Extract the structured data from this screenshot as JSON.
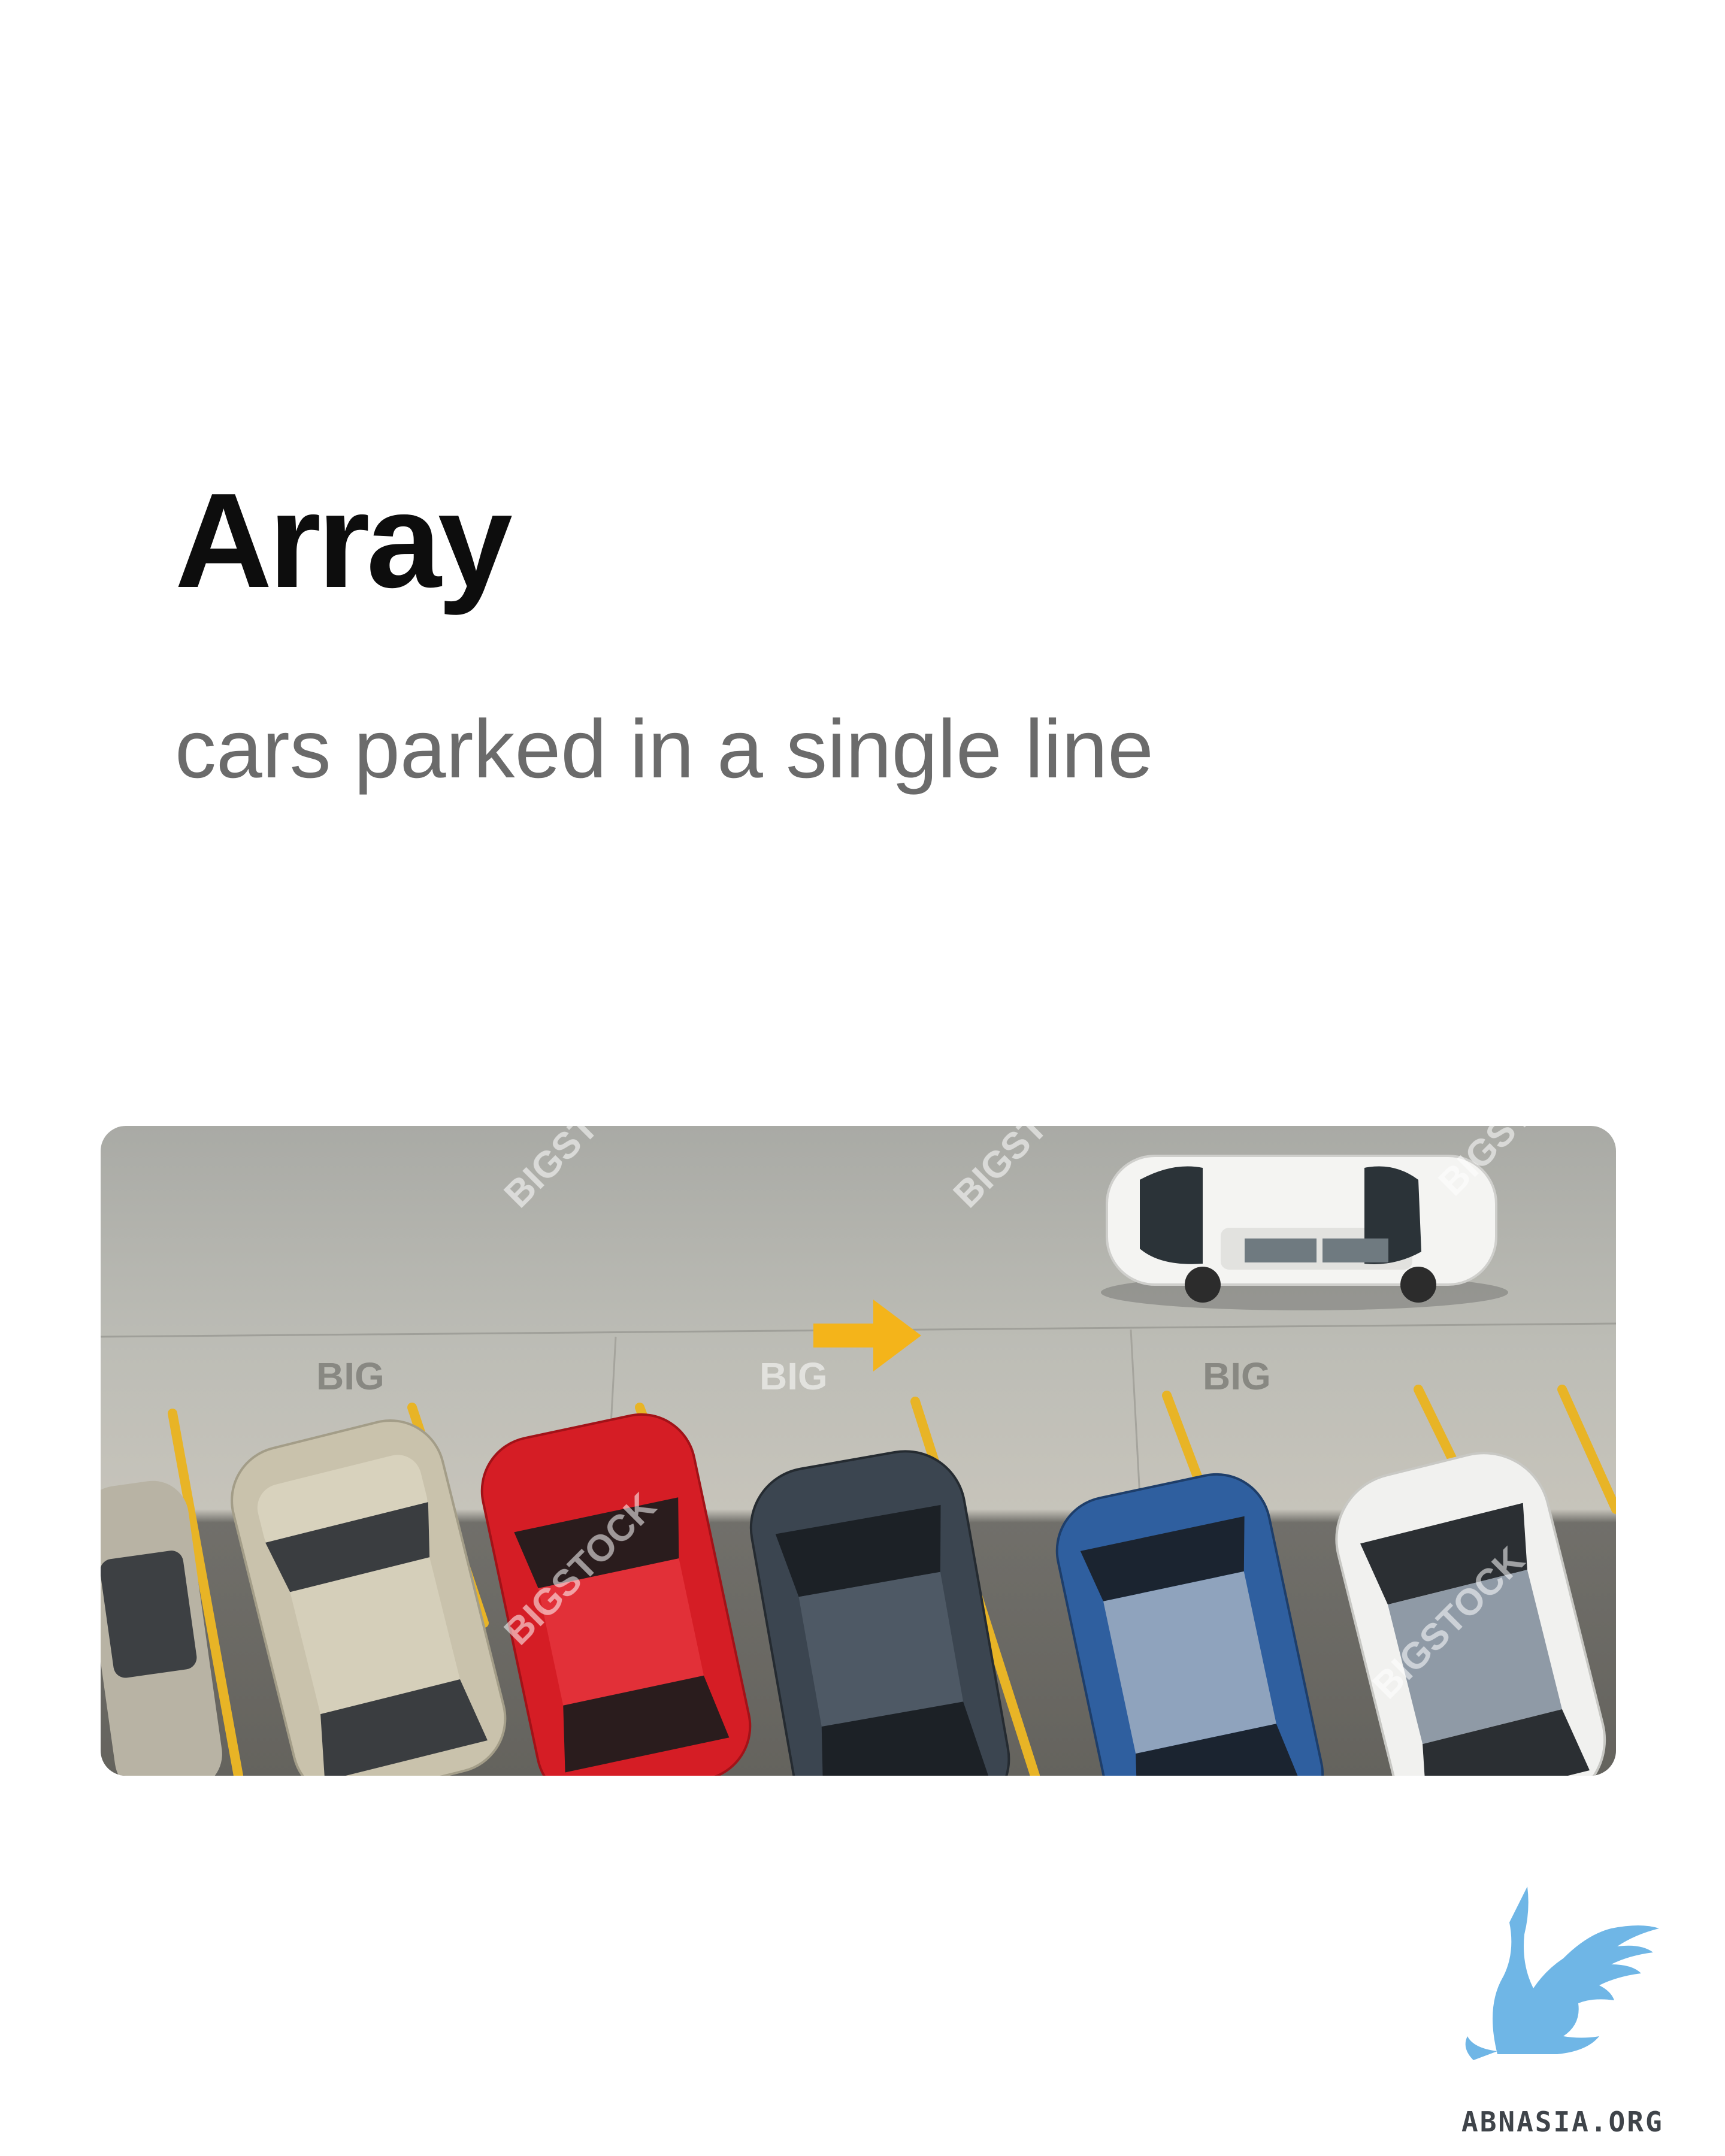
{
  "slide": {
    "title": "Array",
    "subtitle": "cars parked in a single line"
  },
  "photo": {
    "watermarks": {
      "brand": "BIGSTOCK",
      "short": "BIG"
    }
  },
  "brand": {
    "logo_text": "ABNASIA.ORG"
  },
  "colors": {
    "title": "#0d0d0d",
    "subtitle": "#6b6b6b",
    "arrow": "#f4b41a",
    "parking_line": "#e8b426",
    "asphalt": "#b9b9b3",
    "logo_blue": "#6fb6e6"
  },
  "icons": {
    "direction_arrow": "arrow-right-icon",
    "logo": "griffin-logo-icon"
  }
}
